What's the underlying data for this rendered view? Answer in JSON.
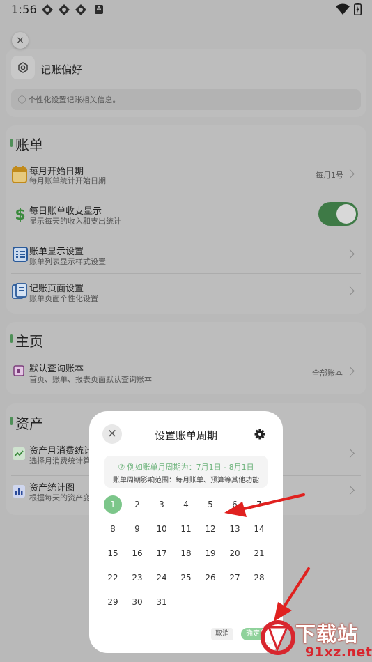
{
  "status_bar": {
    "time": "1:56",
    "notification_badge": "A"
  },
  "prefs": {
    "close_label": "×",
    "title": "记账偏好",
    "info": "ⓘ 个性化设置记账相关信息。"
  },
  "bill_section": {
    "title": "账单",
    "rows": [
      {
        "title": "每月开始日期",
        "subtitle": "每月账单统计开始日期",
        "value": "每月1号"
      },
      {
        "title": "每日账单收支显示",
        "subtitle": "显示每天的收入和支出统计",
        "toggle_on": true
      },
      {
        "title": "账单显示设置",
        "subtitle": "账单列表显示样式设置"
      },
      {
        "title": "记账页面设置",
        "subtitle": "账单页面个性化设置"
      }
    ]
  },
  "home_section": {
    "title": "主页",
    "rows": [
      {
        "title": "默认查询账本",
        "subtitle": "首页、账单、报表页面默认查询账本",
        "value": "全部账本"
      }
    ]
  },
  "asset_section": {
    "title": "资产",
    "rows": [
      {
        "title": "资产月消费统计",
        "subtitle": "选择月消费统计算"
      },
      {
        "title": "资产统计图",
        "subtitle": "根据每天的资产变"
      }
    ]
  },
  "dialog": {
    "close_label": "×",
    "title": "设置账单周期",
    "hint_primary": "⑦ 例如账单月周期为：7月1日 - 8月1日",
    "hint_secondary": "账单周期影响范围：每月账单、预算等其他功能",
    "days": [
      "1",
      "2",
      "3",
      "4",
      "5",
      "6",
      "7",
      "8",
      "9",
      "10",
      "11",
      "12",
      "13",
      "14",
      "15",
      "16",
      "17",
      "18",
      "19",
      "20",
      "21",
      "22",
      "23",
      "24",
      "25",
      "26",
      "27",
      "28",
      "29",
      "30",
      "31"
    ],
    "selected_day": "1",
    "cancel_label": "取消",
    "confirm_label": "确定"
  },
  "watermark": {
    "main": "下载站",
    "sub": "91xz.net"
  },
  "colors": {
    "accent_green": "#7cc68a",
    "toggle_green": "#3e7a46",
    "arrow_red": "#e0211f",
    "watermark_red": "#d8262e"
  },
  "icons": [
    "gear-icon",
    "calendar-icon",
    "dollar-icon",
    "list-icon",
    "ledger-icon",
    "book-icon",
    "trend-chart-icon",
    "bar-chart-icon",
    "close-icon",
    "settings-icon"
  ]
}
